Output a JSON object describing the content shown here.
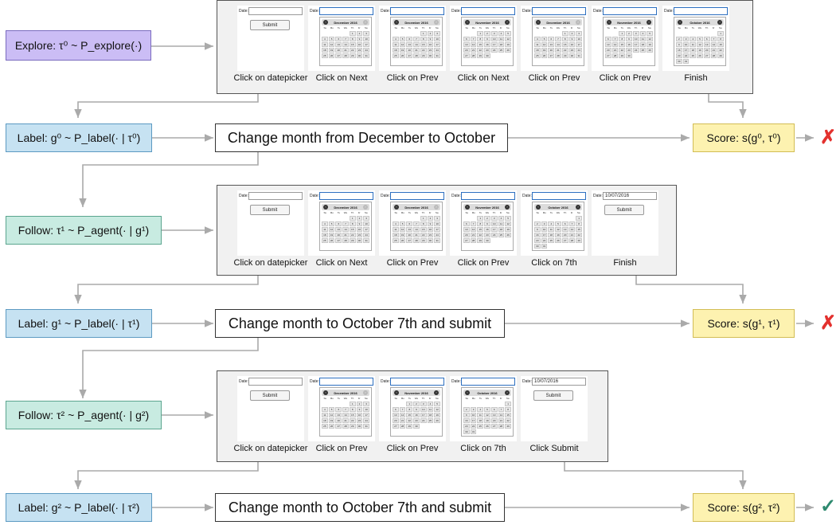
{
  "left_nodes": {
    "explore": "Explore: τ⁰ ~ P_explore(·)",
    "label0": "Label: g⁰ ~ P_label(· | τ⁰)",
    "follow1": "Follow: τ¹ ~ P_agent(· | g¹)",
    "label1": "Label: g¹ ~ P_label(· | τ¹)",
    "follow2": "Follow: τ² ~ P_agent(· | g²)",
    "label2": "Label: g² ~ P_label(· | τ²)"
  },
  "goals": {
    "g0": "Change month from December to October",
    "g1": "Change month to October 7th and submit",
    "g2": "Change month to October 7th and submit"
  },
  "scores": {
    "s0": "Score: s(g⁰, τ⁰)",
    "s1": "Score: s(g¹, τ¹)",
    "s2": "Score: s(g², τ²)"
  },
  "results": {
    "r0": "✗",
    "r1": "✗",
    "r2": "✓"
  },
  "ui": {
    "date_label": "Date:",
    "submit_label": "Submit",
    "date_value": "10/07/2016",
    "weekdays": [
      "Su",
      "Mo",
      "Tu",
      "We",
      "Th",
      "Fr",
      "Sa"
    ],
    "months": {
      "december": "December 2016",
      "november": "November 2016",
      "october": "October 2016"
    }
  },
  "panels": [
    {
      "captions": [
        "Click on datepicker",
        "Click on Next",
        "Click on Prev",
        "Click on Next",
        "Click on Prev",
        "Click on Prev",
        "Finish"
      ]
    },
    {
      "captions": [
        "Click on datepicker",
        "Click on Next",
        "Click on Prev",
        "Click on Prev",
        "Click on 7th",
        "Finish"
      ]
    },
    {
      "captions": [
        "Click on datepicker",
        "Click on Prev",
        "Click on Prev",
        "Click on 7th",
        "Click Submit"
      ]
    }
  ],
  "colors": {
    "explore": "#cbbdf5",
    "label": "#c6e2f2",
    "follow": "#c8ebe1",
    "score": "#fdf2b0",
    "fail": "#e3312e",
    "success": "#2e8a6f"
  }
}
